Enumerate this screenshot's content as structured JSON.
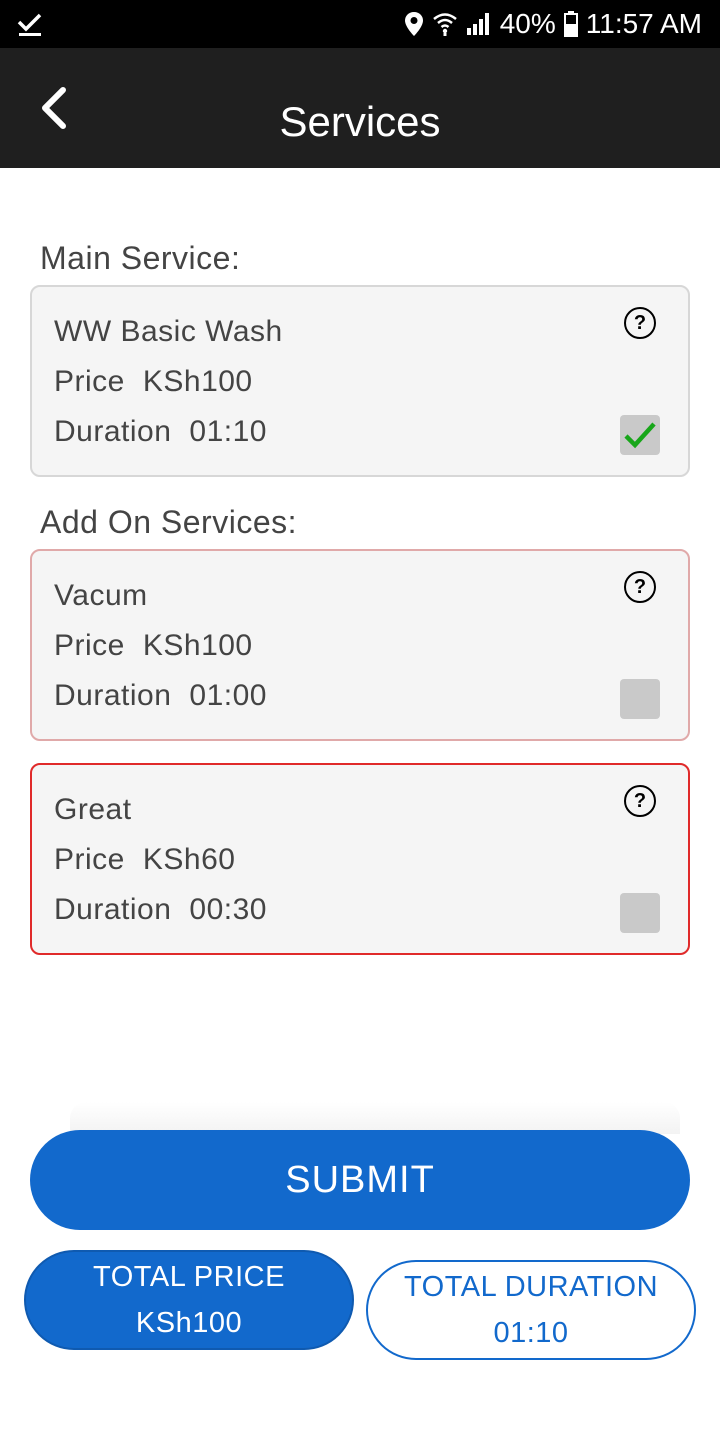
{
  "status_bar": {
    "battery": "40%",
    "time": "11:57 AM"
  },
  "header": {
    "title": "Services"
  },
  "main_service": {
    "label": "Main Service:",
    "item": {
      "name": "WW Basic Wash",
      "price_label": "Price",
      "price": "KSh100",
      "duration_label": "Duration",
      "duration": "01:10",
      "checked": true
    }
  },
  "addon_services": {
    "label": "Add On Services:",
    "items": [
      {
        "name": "Vacum",
        "price_label": "Price",
        "price": "KSh100",
        "duration_label": "Duration",
        "duration": "01:00",
        "checked": false
      },
      {
        "name": "Great",
        "price_label": "Price",
        "price": "KSh60",
        "duration_label": "Duration",
        "duration": "00:30",
        "checked": false
      }
    ]
  },
  "help_glyph": "?",
  "submit_label": "SUBMIT",
  "totals": {
    "price_label": "TOTAL PRICE",
    "price_value": "KSh100",
    "duration_label": "TOTAL DURATION",
    "duration_value": "01:10"
  },
  "colors": {
    "primary": "#1269cc",
    "header_bg": "#1f1f1f",
    "check": "#18a61a",
    "error_border": "#e02a2a"
  }
}
